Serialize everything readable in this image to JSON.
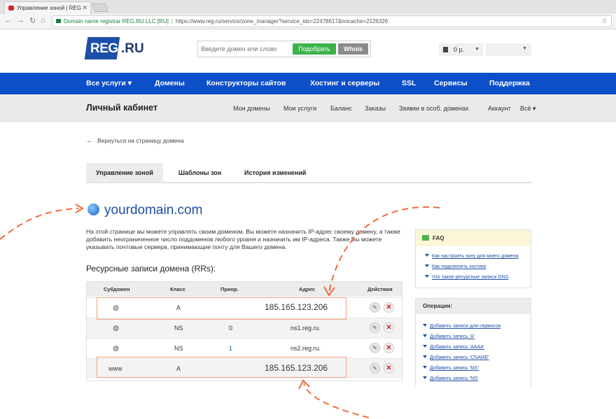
{
  "browser": {
    "tab_title": "Управление зоной | REG",
    "secure_label": "Domain name registrar REG.RU LLC [RU]",
    "url": "https://www.reg.ru/service/zone_manager?service_ids=22478617&nocache=2126326"
  },
  "header": {
    "logo_reg": "REG",
    "logo_ru": ".RU",
    "search_placeholder": "Введите домен или слово",
    "pick_button": "Подобрать",
    "whois_button": "Whois",
    "balance": "0 р."
  },
  "main_nav": {
    "items": [
      "Все услуги ▾",
      "Домены",
      "Конструкторы сайтов",
      "Хостинг и серверы",
      "SSL",
      "Сервисы",
      "Поддержка"
    ]
  },
  "sub_nav": {
    "title": "Личный кабинет",
    "links": [
      "Мои домены",
      "Мои услуги",
      "Баланс",
      "Заказы",
      "Заявки в особ. доменах",
      "Аккаунт",
      "Всё ▾"
    ]
  },
  "back_link": "Вернуться на страницу домена",
  "tabs": [
    "Управление зоной",
    "Шаблоны зон",
    "История изменений"
  ],
  "domain": "yourdomain.com",
  "description": "На этой странице вы можете управлять своим доменом. Вы можете назначить IP-адрес своему домену, а также добавить неограниченное число поддоменов любого уровня и назначить им IP-адреса. Также Вы можете указывать почтовые сервера, принимающие почту для Вашего домена.",
  "rr_heading": "Ресурсные записи домена (RRs):",
  "rr_table": {
    "columns": [
      "Субдомен",
      "Класс",
      "Приор.",
      "Адрес",
      "Действия"
    ],
    "rows": [
      {
        "sub": "@",
        "cls": "A",
        "prio": "",
        "addr": "185.165.123.206"
      },
      {
        "sub": "@",
        "cls": "NS",
        "prio": "0",
        "addr": "ns1.reg.ru."
      },
      {
        "sub": "@",
        "cls": "NS",
        "prio": "1",
        "addr": "ns2.reg.ru."
      },
      {
        "sub": "www",
        "cls": "A",
        "prio": "",
        "addr": "185.165.123.206"
      }
    ]
  },
  "faq": {
    "title": "FAQ",
    "links": [
      "Как настроить зону для моего домена",
      "Как подключить хостинг",
      "Что такое ресурсные записи DNS"
    ]
  },
  "operations": {
    "title": "Операции:",
    "links": [
      "Добавить записи для сервисов",
      "Добавить запись 'A'",
      "Добавить запись 'AAAA'",
      "Добавить запись 'CNAME'",
      "Добавить запись 'MX'",
      "Добавить запись 'NS'"
    ]
  },
  "colors": {
    "nav_blue": "#0d4fc8",
    "logo_blue": "#1d4ea8",
    "pick_green": "#3bb34a",
    "annotation_orange": "#f26b3a",
    "delete_red": "#d02020"
  }
}
